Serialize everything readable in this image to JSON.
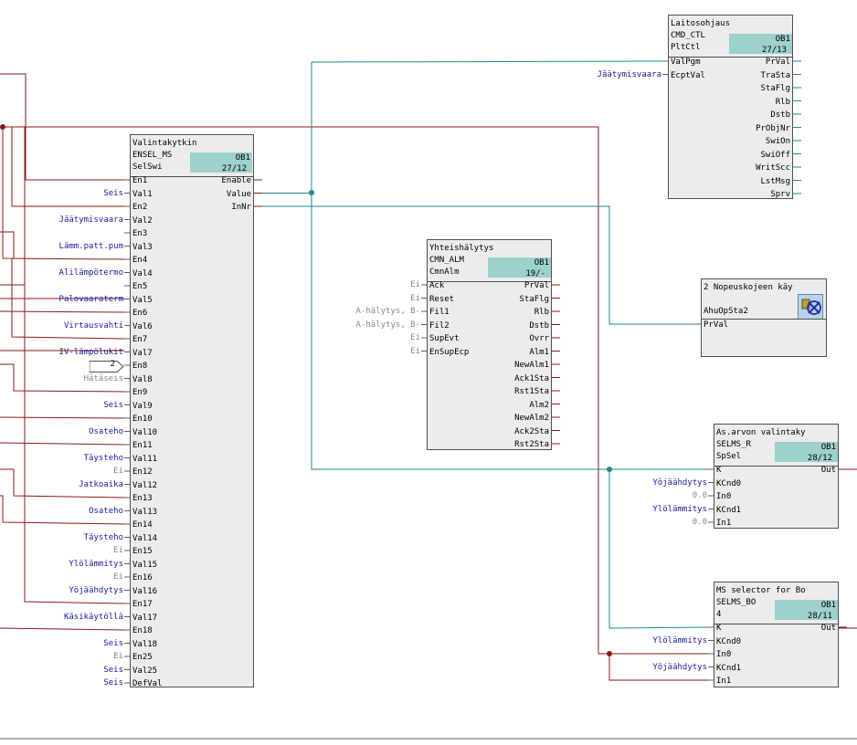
{
  "blocks": [
    {
      "id": "valinta",
      "title": "Valintakytkin",
      "type": "ENSEL_MS",
      "inst": "SelSwi",
      "ob": "OB1",
      "nr": "27/12",
      "inputs": [
        "En1",
        "Val1",
        "En2",
        "Val2",
        "En3",
        "Val3",
        "En4",
        "Val4",
        "En5",
        "Val5",
        "En6",
        "Val6",
        "En7",
        "Val7",
        "En8",
        "Val8",
        "En9",
        "Val9",
        "En10",
        "Val10",
        "En11",
        "Val11",
        "En12",
        "Val12",
        "En13",
        "Val13",
        "En14",
        "Val14",
        "En15",
        "Val15",
        "En16",
        "Val16",
        "En17",
        "Val17",
        "En18",
        "Val18",
        "En25",
        "Val25",
        "DefVal"
      ],
      "outputs": [
        "Enable",
        "Value",
        "InNr"
      ]
    },
    {
      "id": "laitos",
      "title": "Laitosohjaus",
      "type": "CMD_CTL",
      "inst": "PltCtl",
      "ob": "OB1",
      "nr": "27/13",
      "inputs": [
        "ValPgm",
        "EcptVal"
      ],
      "outputs": [
        "PrVal",
        "TraSta",
        "StaFlg",
        "Rlb",
        "Dstb",
        "PrObjNr",
        "SwiOn",
        "SwiOff",
        "WritScc",
        "LstMsg",
        "Sprv"
      ]
    },
    {
      "id": "yhteis",
      "title": "Yhteishälytys",
      "type": "CMN_ALM",
      "inst": "CmnAlm",
      "ob": "OB1",
      "nr": "19/-",
      "inputs": [
        "Ack",
        "Reset",
        "Fil1",
        "Fil2",
        "SupEvt",
        "EnSupEcp"
      ],
      "outputs": [
        "PrVal",
        "StaFlg",
        "Rlb",
        "Dstb",
        "Ovrr",
        "Alm1",
        "NewAlm1",
        "Ack1Sta",
        "Rst1Sta",
        "Alm2",
        "NewAlm2",
        "Ack2Sta",
        "Rst2Sta"
      ]
    },
    {
      "id": "nopeus",
      "title": "2 Nopeuskojeen käy",
      "inst": "AhuOpSta2",
      "inputs": [
        "PrVal"
      ],
      "outputs": []
    },
    {
      "id": "asarvo",
      "title": "As.arvon valintaky",
      "type": "SELMS_R",
      "inst": "SpSel",
      "ob": "OB1",
      "nr": "28/12",
      "inputs": [
        "K",
        "KCnd0",
        "In0",
        "KCnd1",
        "In1"
      ],
      "outputs": [
        "Out"
      ]
    },
    {
      "id": "msbo",
      "title": "MS selector for Bo",
      "type": "SELMS_BO",
      "inst": "4",
      "ob": "OB1",
      "nr": "28/11",
      "inputs": [
        "K",
        "KCnd0",
        "In0",
        "KCnd1",
        "In1"
      ],
      "outputs": [
        "Out"
      ]
    }
  ],
  "labels": {
    "valinta": [
      {
        "pin": "Val1",
        "text": "Seis",
        "c": "blue"
      },
      {
        "pin": "Val2",
        "text": "Jäätymisvaara",
        "c": "blue"
      },
      {
        "pin": "Val3",
        "text": "Lämm.patt.pum",
        "c": "blue"
      },
      {
        "pin": "Val4",
        "text": "Alilämpötermo",
        "c": "blue"
      },
      {
        "pin": "Val5",
        "text": "Palovaaraterm",
        "c": "blue"
      },
      {
        "pin": "Val6",
        "text": "Virtausvahti",
        "c": "blue"
      },
      {
        "pin": "Val7",
        "text": "IV-lämpölukit",
        "c": "blue"
      },
      {
        "pin": "Val8",
        "text": "Hätäseis",
        "c": "gray"
      },
      {
        "pin": "Val9",
        "text": "Seis",
        "c": "blue"
      },
      {
        "pin": "Val10",
        "text": "Osateho",
        "c": "blue"
      },
      {
        "pin": "Val11",
        "text": "Täysteho",
        "c": "blue"
      },
      {
        "pin": "En12",
        "text": "Ei",
        "c": "gray"
      },
      {
        "pin": "Val12",
        "text": "Jatkoaika",
        "c": "blue"
      },
      {
        "pin": "Val13",
        "text": "Osateho",
        "c": "blue"
      },
      {
        "pin": "Val14",
        "text": "Täysteho",
        "c": "blue"
      },
      {
        "pin": "En15",
        "text": "Ei",
        "c": "gray"
      },
      {
        "pin": "Val15",
        "text": "Ylölämmitys",
        "c": "blue"
      },
      {
        "pin": "En16",
        "text": "Ei",
        "c": "gray"
      },
      {
        "pin": "Val16",
        "text": "Yöjäähdytys",
        "c": "blue"
      },
      {
        "pin": "Val17",
        "text": "Käsikäytöllä",
        "c": "blue"
      },
      {
        "pin": "Val18",
        "text": "Seis",
        "c": "blue"
      },
      {
        "pin": "En25",
        "text": "Ei",
        "c": "gray"
      },
      {
        "pin": "Val25",
        "text": "Seis",
        "c": "blue"
      },
      {
        "pin": "DefVal",
        "text": "Seis",
        "c": "blue"
      }
    ],
    "yhteis": [
      {
        "pin": "Ack",
        "text": "Ei",
        "c": "gray"
      },
      {
        "pin": "Reset",
        "text": "Ei",
        "c": "gray"
      },
      {
        "pin": "Fil1",
        "text": "A-hälytys, B-",
        "c": "gray"
      },
      {
        "pin": "Fil2",
        "text": "A-hälytys, B-",
        "c": "gray"
      },
      {
        "pin": "SupEvt",
        "text": "Ei",
        "c": "gray"
      },
      {
        "pin": "EnSupEcp",
        "text": "Ei",
        "c": "gray"
      }
    ],
    "laitos": [
      {
        "pin": "EcptVal",
        "text": "Jäätymisvaara",
        "c": "blue"
      }
    ],
    "asarvo": [
      {
        "pin": "KCnd0",
        "text": "Yöjäähdytys",
        "c": "blue"
      },
      {
        "pin": "In0",
        "text": "0.0",
        "c": "gray"
      },
      {
        "pin": "KCnd1",
        "text": "Ylölämmitys",
        "c": "blue"
      },
      {
        "pin": "In1",
        "text": "0.0",
        "c": "gray"
      }
    ],
    "msbo": [
      {
        "pin": "KCnd0",
        "text": "Ylölämmitys",
        "c": "blue"
      },
      {
        "pin": "KCnd1",
        "text": "Yöjäähdytys",
        "c": "blue"
      }
    ]
  },
  "en8_const": "2",
  "nopeus_icon": "fan-motor-icon"
}
